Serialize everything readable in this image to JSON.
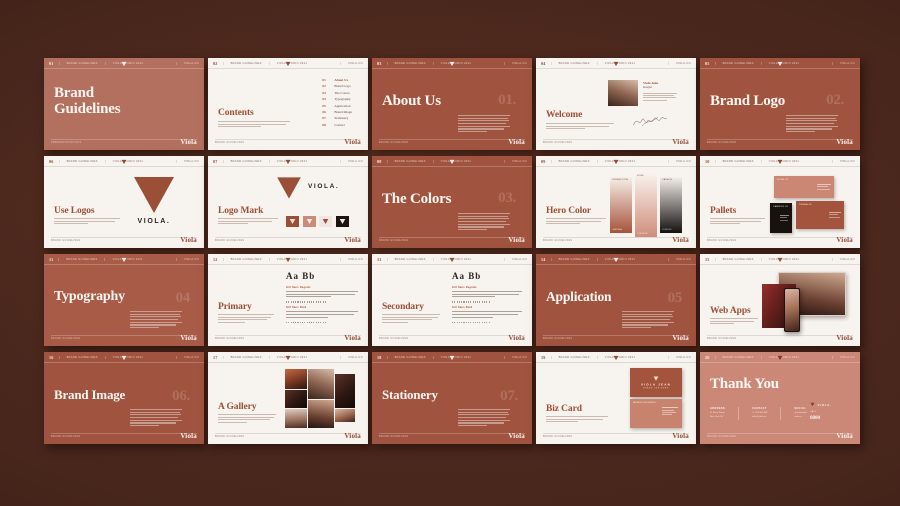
{
  "deck": {
    "brand": "Viola",
    "brand_wordmark": "VIOLA.",
    "background_color": "#48261c",
    "terracotta": "#b4705f",
    "terracotta_dark": "#a0543f",
    "cream": "#f7f3ee",
    "accent_text": "#9e4f35"
  },
  "topbar": {
    "items": [
      "BRAND GUIDELINES",
      "VIOLA STUDIO 2021"
    ],
    "right_label": "VIOLA.CO"
  },
  "footer": {
    "left": "BRAND GUIDELINES",
    "brand": "Viola"
  },
  "slides": [
    {
      "n": "01",
      "title_lines": [
        "Brand",
        "Guidelines"
      ],
      "kind": "cover",
      "bg": "terra",
      "footer": "PRESENTATION 2021"
    },
    {
      "n": "02",
      "title": "Contents",
      "kind": "contents",
      "bg": "cream",
      "toc": [
        {
          "num": "01",
          "label": "About Us",
          "active": true
        },
        {
          "num": "02",
          "label": "Brand Logo",
          "active": false
        },
        {
          "num": "03",
          "label": "The Colors",
          "active": false
        },
        {
          "num": "04",
          "label": "Typography",
          "active": false
        },
        {
          "num": "05",
          "label": "Application",
          "active": false
        },
        {
          "num": "06",
          "label": "Brand Image",
          "active": false
        },
        {
          "num": "07",
          "label": "Stationery",
          "active": false
        },
        {
          "num": "08",
          "label": "Contact",
          "active": false
        }
      ]
    },
    {
      "n": "03",
      "title": "About Us",
      "kind": "section",
      "bg": "terra-dark",
      "number": "01."
    },
    {
      "n": "04",
      "title": "Welcome",
      "kind": "welcome",
      "bg": "cream",
      "person": {
        "name": "Viola Jean",
        "role": "Designer"
      }
    },
    {
      "n": "05",
      "title": "Brand Logo",
      "kind": "section",
      "bg": "terra-dark",
      "number": "02."
    },
    {
      "n": "06",
      "title": "Use Logos",
      "kind": "use-logos",
      "bg": "cream",
      "wordmark": "VIOLA."
    },
    {
      "n": "07",
      "title": "Logo Mark",
      "kind": "logo-mark",
      "bg": "cream",
      "wordmark": "VIOLA.",
      "swatches": [
        "#9b4f37",
        "#cc8a78",
        "#f1e7e0",
        "#1b1413"
      ]
    },
    {
      "n": "08",
      "title": "The Colors",
      "kind": "section",
      "bg": "terra-dark",
      "number": "03."
    },
    {
      "n": "09",
      "title": "Hero Color",
      "kind": "hero-color",
      "bg": "cream",
      "bars": [
        {
          "label": "TERRACOTTA",
          "from": "#ffffff",
          "to": "#a6533a",
          "code": "#A6533A"
        },
        {
          "label": "ROSE",
          "from": "#ffffff",
          "to": "#cf8d7b",
          "code": "#CF8D7B"
        },
        {
          "label": "CARBON",
          "from": "#ffffff",
          "to": "#131010",
          "code": "#131010"
        }
      ]
    },
    {
      "n": "10",
      "title": "Pallets",
      "kind": "pallets",
      "bg": "cream",
      "cards": [
        {
          "label": "ROSE 01",
          "color": "#cb8674",
          "text": "#fdf3ef"
        },
        {
          "label": "CARBON 02",
          "color": "#18120f",
          "text": "#f3ece7"
        },
        {
          "label": "TERRA 03",
          "color": "#a4543c",
          "text": "#fdf3ef"
        }
      ]
    },
    {
      "n": "11",
      "title": "Typography",
      "kind": "section",
      "bg": "terra-mid",
      "number": "04"
    },
    {
      "n": "12",
      "title": "Primary",
      "kind": "type",
      "bg": "cream",
      "specimen": "Aa  Bb",
      "blocks": [
        {
          "label": "Gill Sans Regular"
        },
        {
          "label": "Gill Sans Bold"
        }
      ]
    },
    {
      "n": "13",
      "title": "Secondary",
      "kind": "type",
      "bg": "cream",
      "specimen": "Aa  Bb",
      "blocks": [
        {
          "label": "Gill Sans Regular"
        },
        {
          "label": "Gill Sans Bold"
        }
      ]
    },
    {
      "n": "14",
      "title": "Application",
      "kind": "section",
      "bg": "terra-dark",
      "number": "05"
    },
    {
      "n": "15",
      "title": "Web Apps",
      "kind": "web-apps",
      "bg": "cream"
    },
    {
      "n": "16",
      "title": "Brand Image",
      "kind": "section",
      "bg": "terra-dark",
      "number": "06."
    },
    {
      "n": "17",
      "title": "A Gallery",
      "kind": "gallery",
      "bg": "cream"
    },
    {
      "n": "18",
      "title": "Stationery",
      "kind": "section",
      "bg": "terra-dark",
      "number": "07."
    },
    {
      "n": "19",
      "title": "Biz Card",
      "kind": "biz-card",
      "bg": "cream",
      "card": {
        "name": "VIOLA JEAN",
        "sub": "BRAND DESIGNER"
      }
    },
    {
      "n": "20",
      "title": "Thank You",
      "kind": "thanks",
      "bg": "salmon",
      "columns": [
        {
          "head": "ADDRESS",
          "lines": "21 Rose Street\nNew York, NY"
        },
        {
          "head": "CONTACT",
          "lines": "+1 234 567 890\nhello@viola.co"
        },
        {
          "head": "SOCIAL",
          "lines": "@violastudio\nviola.co"
        }
      ],
      "card": {
        "brand": "VIOLA.",
        "label": "CALL",
        "number": "0800"
      }
    }
  ]
}
